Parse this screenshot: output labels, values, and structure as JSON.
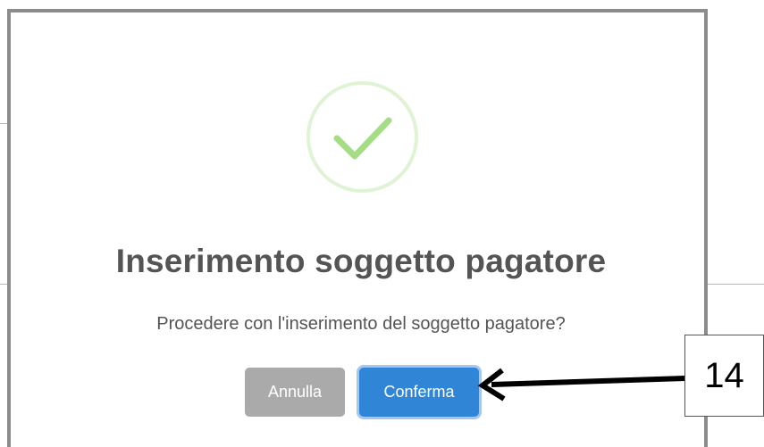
{
  "dialog": {
    "title": "Inserimento soggetto pagatore",
    "message": "Procedere con l'inserimento del soggetto pagatore?",
    "icon": "checkmark-icon",
    "cancel_label": "Annulla",
    "confirm_label": "Conferma"
  },
  "annotation": {
    "step_number": "14",
    "arrow": "arrow-left-icon"
  },
  "colors": {
    "success": "#a5dc86",
    "confirm": "#3085d6",
    "cancel": "#aaaaaa",
    "text": "#545454",
    "modal_border": "#8c8c8c"
  }
}
